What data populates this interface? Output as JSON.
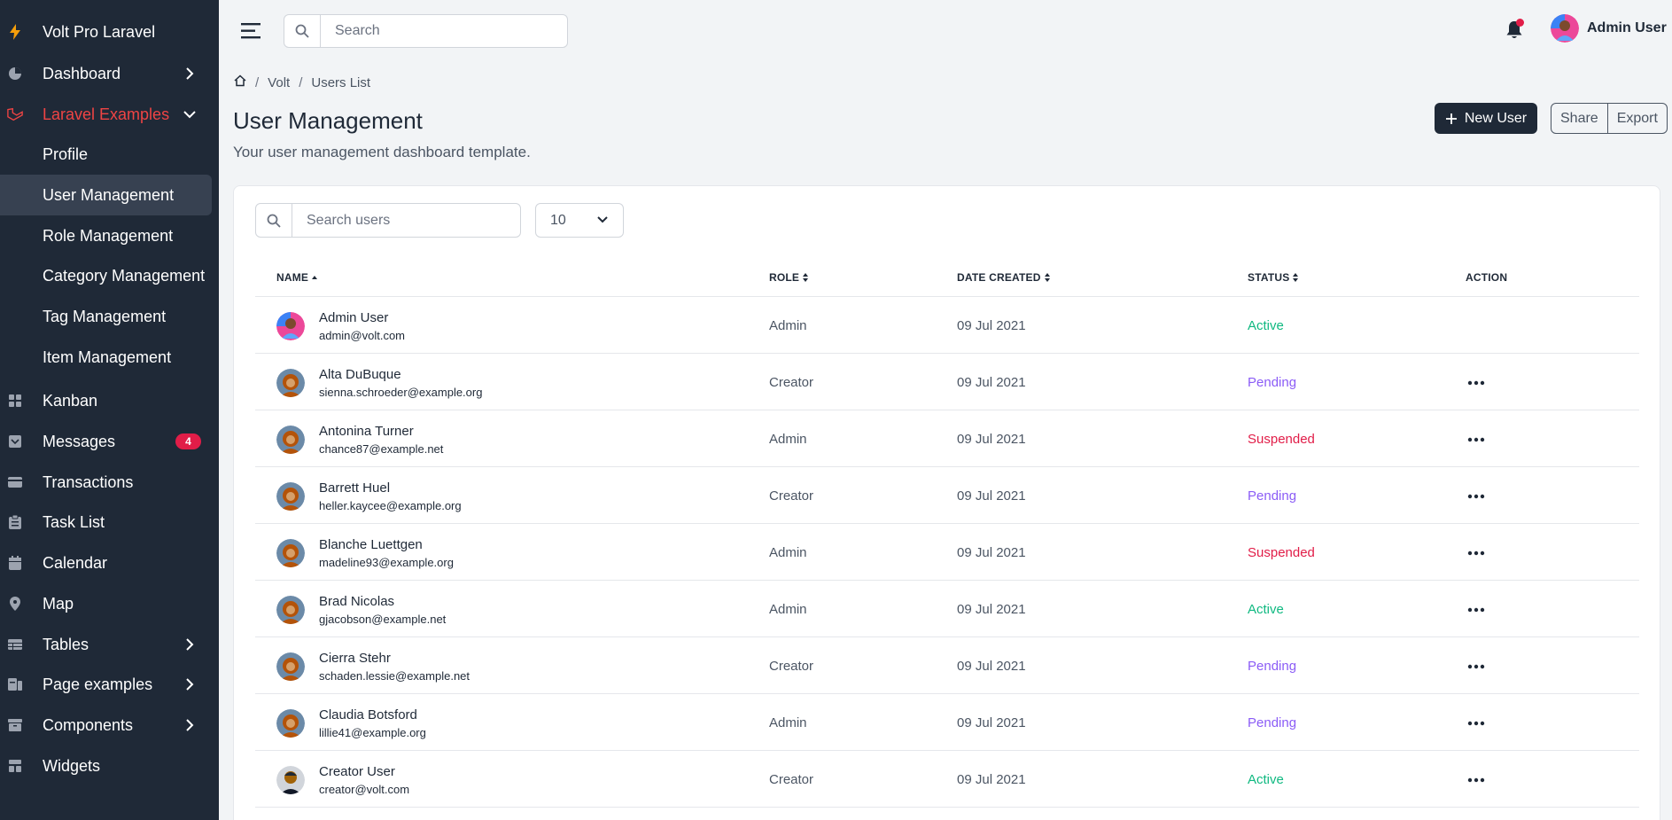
{
  "app": {
    "brand": "Volt Pro Laravel"
  },
  "sidebar": {
    "items": [
      {
        "label": "Dashboard",
        "icon": "pie-chart-icon",
        "has_chevron": true
      },
      {
        "label": "Laravel Examples",
        "icon": "laravel-icon",
        "expanded": true
      },
      {
        "label": "Profile"
      },
      {
        "label": "User Management",
        "active": true
      },
      {
        "label": "Role Management"
      },
      {
        "label": "Category Management"
      },
      {
        "label": "Tag Management"
      },
      {
        "label": "Item Management"
      },
      {
        "label": "Kanban",
        "icon": "grid-icon"
      },
      {
        "label": "Messages",
        "icon": "inbox-icon",
        "badge": "4"
      },
      {
        "label": "Transactions",
        "icon": "credit-card-icon"
      },
      {
        "label": "Task List",
        "icon": "clipboard-icon"
      },
      {
        "label": "Calendar",
        "icon": "calendar-icon"
      },
      {
        "label": "Map",
        "icon": "map-pin-icon"
      },
      {
        "label": "Tables",
        "icon": "table-icon",
        "has_chevron": true
      },
      {
        "label": "Page examples",
        "icon": "pages-icon",
        "has_chevron": true
      },
      {
        "label": "Components",
        "icon": "archive-icon",
        "has_chevron": true
      },
      {
        "label": "Widgets",
        "icon": "widgets-icon"
      }
    ]
  },
  "topbar": {
    "search_placeholder": "Search",
    "user_name": "Admin User"
  },
  "breadcrumb": {
    "items": [
      "Volt",
      "Users List"
    ]
  },
  "page": {
    "title": "User Management",
    "subtitle": "Your user management dashboard template.",
    "new_user_label": "New User",
    "share_label": "Share",
    "export_label": "Export"
  },
  "table": {
    "search_placeholder": "Search users",
    "per_page": "10",
    "columns": {
      "name": "NAME",
      "role": "ROLE",
      "date": "DATE CREATED",
      "status": "STATUS",
      "action": "ACTION"
    },
    "status_colors": {
      "Active": "#10b981",
      "Pending": "#8b5cf6",
      "Suspended": "#e11d48"
    },
    "rows": [
      {
        "name": "Admin User",
        "email": "admin@volt.com",
        "role": "Admin",
        "date": "09 Jul 2021",
        "status": "Active",
        "has_action": false,
        "avatar": "admin"
      },
      {
        "name": "Alta DuBuque",
        "email": "sienna.schroeder@example.org",
        "role": "Creator",
        "date": "09 Jul 2021",
        "status": "Pending",
        "has_action": true,
        "avatar": "default"
      },
      {
        "name": "Antonina Turner",
        "email": "chance87@example.net",
        "role": "Admin",
        "date": "09 Jul 2021",
        "status": "Suspended",
        "has_action": true,
        "avatar": "default"
      },
      {
        "name": "Barrett Huel",
        "email": "heller.kaycee@example.org",
        "role": "Creator",
        "date": "09 Jul 2021",
        "status": "Pending",
        "has_action": true,
        "avatar": "default"
      },
      {
        "name": "Blanche Luettgen",
        "email": "madeline93@example.org",
        "role": "Admin",
        "date": "09 Jul 2021",
        "status": "Suspended",
        "has_action": true,
        "avatar": "default"
      },
      {
        "name": "Brad Nicolas",
        "email": "gjacobson@example.net",
        "role": "Admin",
        "date": "09 Jul 2021",
        "status": "Active",
        "has_action": true,
        "avatar": "default"
      },
      {
        "name": "Cierra Stehr",
        "email": "schaden.lessie@example.net",
        "role": "Creator",
        "date": "09 Jul 2021",
        "status": "Pending",
        "has_action": true,
        "avatar": "default"
      },
      {
        "name": "Claudia Botsford",
        "email": "lillie41@example.org",
        "role": "Admin",
        "date": "09 Jul 2021",
        "status": "Pending",
        "has_action": true,
        "avatar": "default"
      },
      {
        "name": "Creator User",
        "email": "creator@volt.com",
        "role": "Creator",
        "date": "09 Jul 2021",
        "status": "Active",
        "has_action": true,
        "avatar": "creator"
      }
    ]
  }
}
